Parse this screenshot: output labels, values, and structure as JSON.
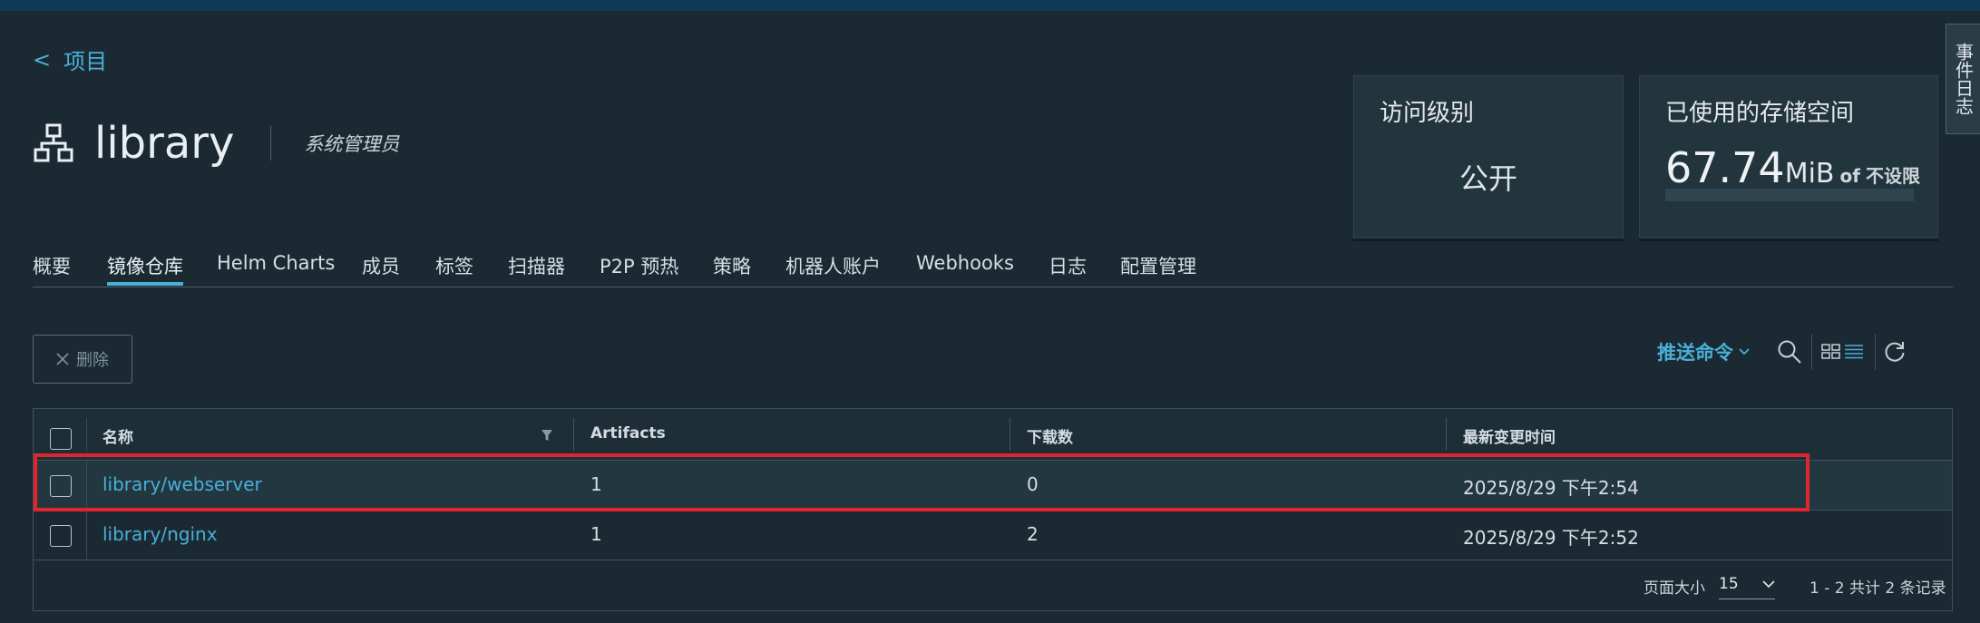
{
  "breadcrumb": {
    "back_symbol": "<",
    "label": "项目"
  },
  "project": {
    "name": "library",
    "role": "系统管理员"
  },
  "cards": {
    "access": {
      "title": "访问级别",
      "value": "公开"
    },
    "storage": {
      "title": "已使用的存储空间",
      "value": "67.74",
      "unit": "MiB",
      "of": "of",
      "quota": "不设限",
      "usage_fraction": 0
    }
  },
  "side_tab": {
    "label": "事件日志"
  },
  "tabs": [
    {
      "label": "概要"
    },
    {
      "label": "镜像仓库"
    },
    {
      "label": "Helm Charts"
    },
    {
      "label": "成员"
    },
    {
      "label": "标签"
    },
    {
      "label": "扫描器"
    },
    {
      "label": "P2P 预热"
    },
    {
      "label": "策略"
    },
    {
      "label": "机器人账户"
    },
    {
      "label": "Webhooks"
    },
    {
      "label": "日志"
    },
    {
      "label": "配置管理"
    }
  ],
  "active_tab": "镜像仓库",
  "toolbar": {
    "delete_label": "删除",
    "push_command_label": "推送命令",
    "icons": [
      "search-icon",
      "card-view-icon",
      "list-view-icon",
      "refresh-icon"
    ]
  },
  "table": {
    "columns": [
      "名称",
      "Artifacts",
      "下载数",
      "最新变更时间"
    ],
    "rows": [
      {
        "name": "library/webserver",
        "artifacts": "1",
        "pulls": "0",
        "updated": "2025/8/29 下午2:54"
      },
      {
        "name": "library/nginx",
        "artifacts": "1",
        "pulls": "2",
        "updated": "2025/8/29 下午2:52"
      }
    ]
  },
  "footer": {
    "page_size_label": "页面大小",
    "page_size": "15",
    "summary": "1 - 2 共计 2 条记录"
  },
  "colors": {
    "accent": "#49afd9",
    "background": "#1b2a32",
    "highlight": "#e0262c"
  }
}
